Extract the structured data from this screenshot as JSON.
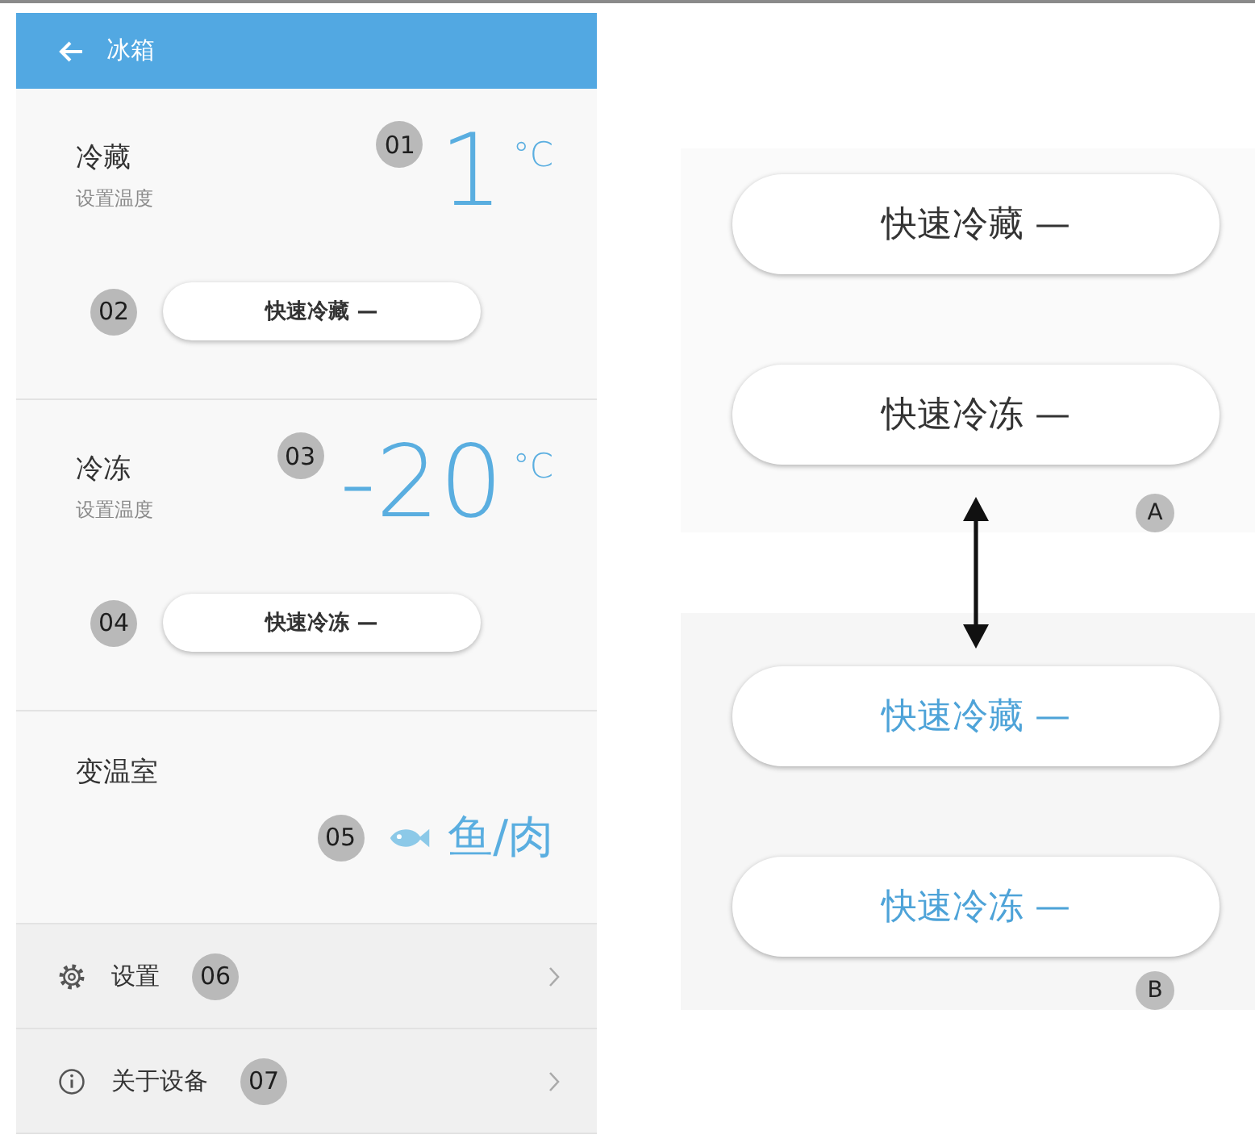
{
  "header": {
    "title": "冰箱"
  },
  "compartments": [
    {
      "kind": "temperature",
      "name": "冷藏",
      "subtitle": "设置温度",
      "marker": "01",
      "temperature": "1",
      "unit": "°C",
      "button": {
        "label": "快速冷藏 —",
        "on": false,
        "marker": "02"
      }
    },
    {
      "kind": "temperature",
      "name": "冷冻",
      "subtitle": "设置温度",
      "marker": "03",
      "temperature": "-20",
      "unit": "°C",
      "button": {
        "label": "快速冷冻 —",
        "on": false,
        "marker": "04"
      }
    },
    {
      "kind": "mode",
      "name": "变温室",
      "marker": "05",
      "mode": "鱼/肉"
    }
  ],
  "menu": [
    {
      "kind": "settings",
      "label": "设置",
      "marker": "06"
    },
    {
      "kind": "info",
      "label": "关于设备",
      "marker": "07"
    }
  ],
  "comparison": {
    "groups": [
      {
        "marker": "A",
        "buttons": [
          {
            "label": "快速冷藏 —",
            "on": false
          },
          {
            "label": "快速冷冻 —",
            "on": false
          }
        ]
      },
      {
        "marker": "B",
        "buttons": [
          {
            "label": "快速冷藏 —",
            "on": true
          },
          {
            "label": "快速冷冻 —",
            "on": true
          }
        ]
      }
    ]
  }
}
